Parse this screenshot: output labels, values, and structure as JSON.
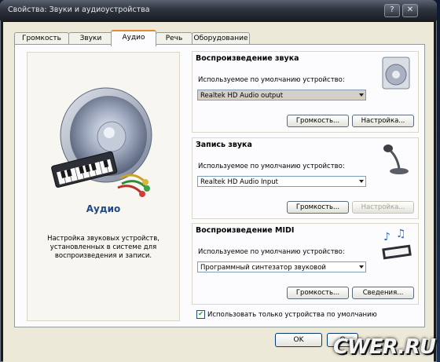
{
  "window": {
    "title": "Свойства: Звуки и аудиоустройства",
    "help_glyph": "?",
    "close_glyph": "✕"
  },
  "tabs": [
    {
      "label": "Громкость",
      "active": false
    },
    {
      "label": "Звуки",
      "active": false
    },
    {
      "label": "Аудио",
      "active": true
    },
    {
      "label": "Речь",
      "active": false
    },
    {
      "label": "Оборудование",
      "active": false
    }
  ],
  "left_panel": {
    "heading": "Аудио",
    "description": "Настройка звуковых устройств, установленных в системе для воспроизведения и записи.",
    "icon": "speaker-keyboard-icon"
  },
  "groups": {
    "playback": {
      "title": "Воспроизведение звука",
      "label": "Используемое по умолчанию устройство:",
      "device": "Realtek HD Audio output",
      "buttons": [
        "Громкость...",
        "Настройка..."
      ],
      "icon": "speaker-icon"
    },
    "recording": {
      "title": "Запись звука",
      "label": "Используемое по умолчанию устройство:",
      "device": "Realtek HD Audio Input",
      "buttons": [
        "Громкость...",
        "Настройка..."
      ],
      "icon": "microphone-icon"
    },
    "midi": {
      "title": "Воспроизведение MIDI",
      "label": "Используемое по умолчанию устройство:",
      "device": "Программный синтезатор звуковой",
      "buttons": [
        "Громкость...",
        "Сведения..."
      ],
      "icon": "midi-keyboard-icon"
    }
  },
  "checkbox": {
    "label": "Использовать только устройства по умолчанию",
    "checked": true
  },
  "dialog_buttons": {
    "ok": "OK",
    "cancel_partial": "О"
  },
  "watermark": "CWER.RU",
  "colors": {
    "heading_blue": "#1e4a8c",
    "tab_accent": "#e68b2c",
    "dialog_bg": "#ece9d8"
  }
}
